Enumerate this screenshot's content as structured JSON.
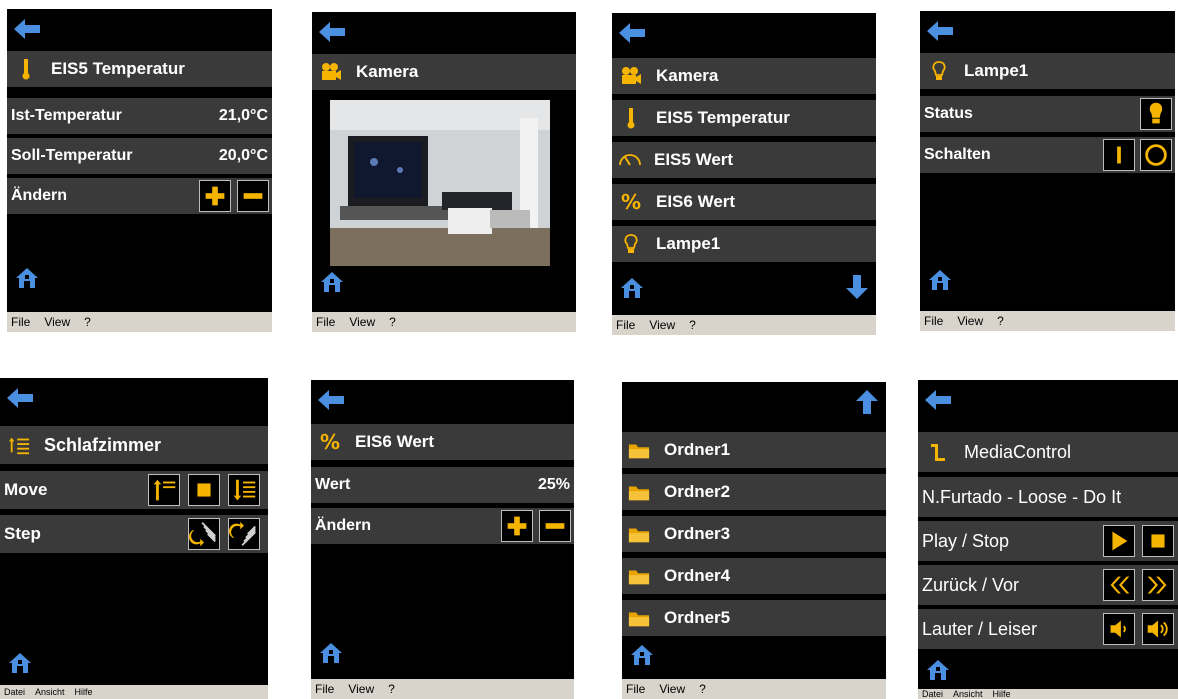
{
  "screens": {
    "temp": {
      "title": "EIS5 Temperatur",
      "rows": [
        {
          "label": "Ist-Temperatur",
          "value": "21,0°C"
        },
        {
          "label": "Soll-Temperatur",
          "value": "20,0°C"
        },
        {
          "label": "Ändern"
        }
      ],
      "menu": [
        "File",
        "View",
        "?"
      ]
    },
    "kamera": {
      "title": "Kamera",
      "menu": [
        "File",
        "View",
        "?"
      ]
    },
    "list": {
      "items": [
        "Kamera",
        "EIS5 Temperatur",
        "EIS5 Wert",
        "EIS6 Wert",
        "Lampe1"
      ],
      "menu": [
        "File",
        "View",
        "?"
      ]
    },
    "lampe": {
      "title": "Lampe1",
      "rows": [
        {
          "label": "Status"
        },
        {
          "label": "Schalten"
        }
      ],
      "menu": [
        "File",
        "View",
        "?"
      ]
    },
    "schlaf": {
      "title": "Schlafzimmer",
      "rows": [
        {
          "label": "Move"
        },
        {
          "label": "Step"
        }
      ],
      "menu": [
        "Datei",
        "Ansicht",
        "Hilfe"
      ]
    },
    "eis6": {
      "title": "EIS6 Wert",
      "rows": [
        {
          "label": "Wert",
          "value": "25%"
        },
        {
          "label": "Ändern"
        }
      ],
      "menu": [
        "File",
        "View",
        "?"
      ]
    },
    "ordner": {
      "items": [
        "Ordner1",
        "Ordner2",
        "Ordner3",
        "Ordner4",
        "Ordner5"
      ],
      "menu": [
        "File",
        "View",
        "?"
      ]
    },
    "media": {
      "title": "MediaControl",
      "track": "N.Furtado - Loose - Do It",
      "rows": [
        {
          "label": "Play / Stop"
        },
        {
          "label": "Zurück / Vor"
        },
        {
          "label": "Lauter / Leiser"
        }
      ],
      "menu": [
        "Datei",
        "Ansicht",
        "Hilfe"
      ]
    }
  },
  "colors": {
    "accent": "#f5b400",
    "blue": "#4a8fe0",
    "row": "#3a3a3a"
  }
}
